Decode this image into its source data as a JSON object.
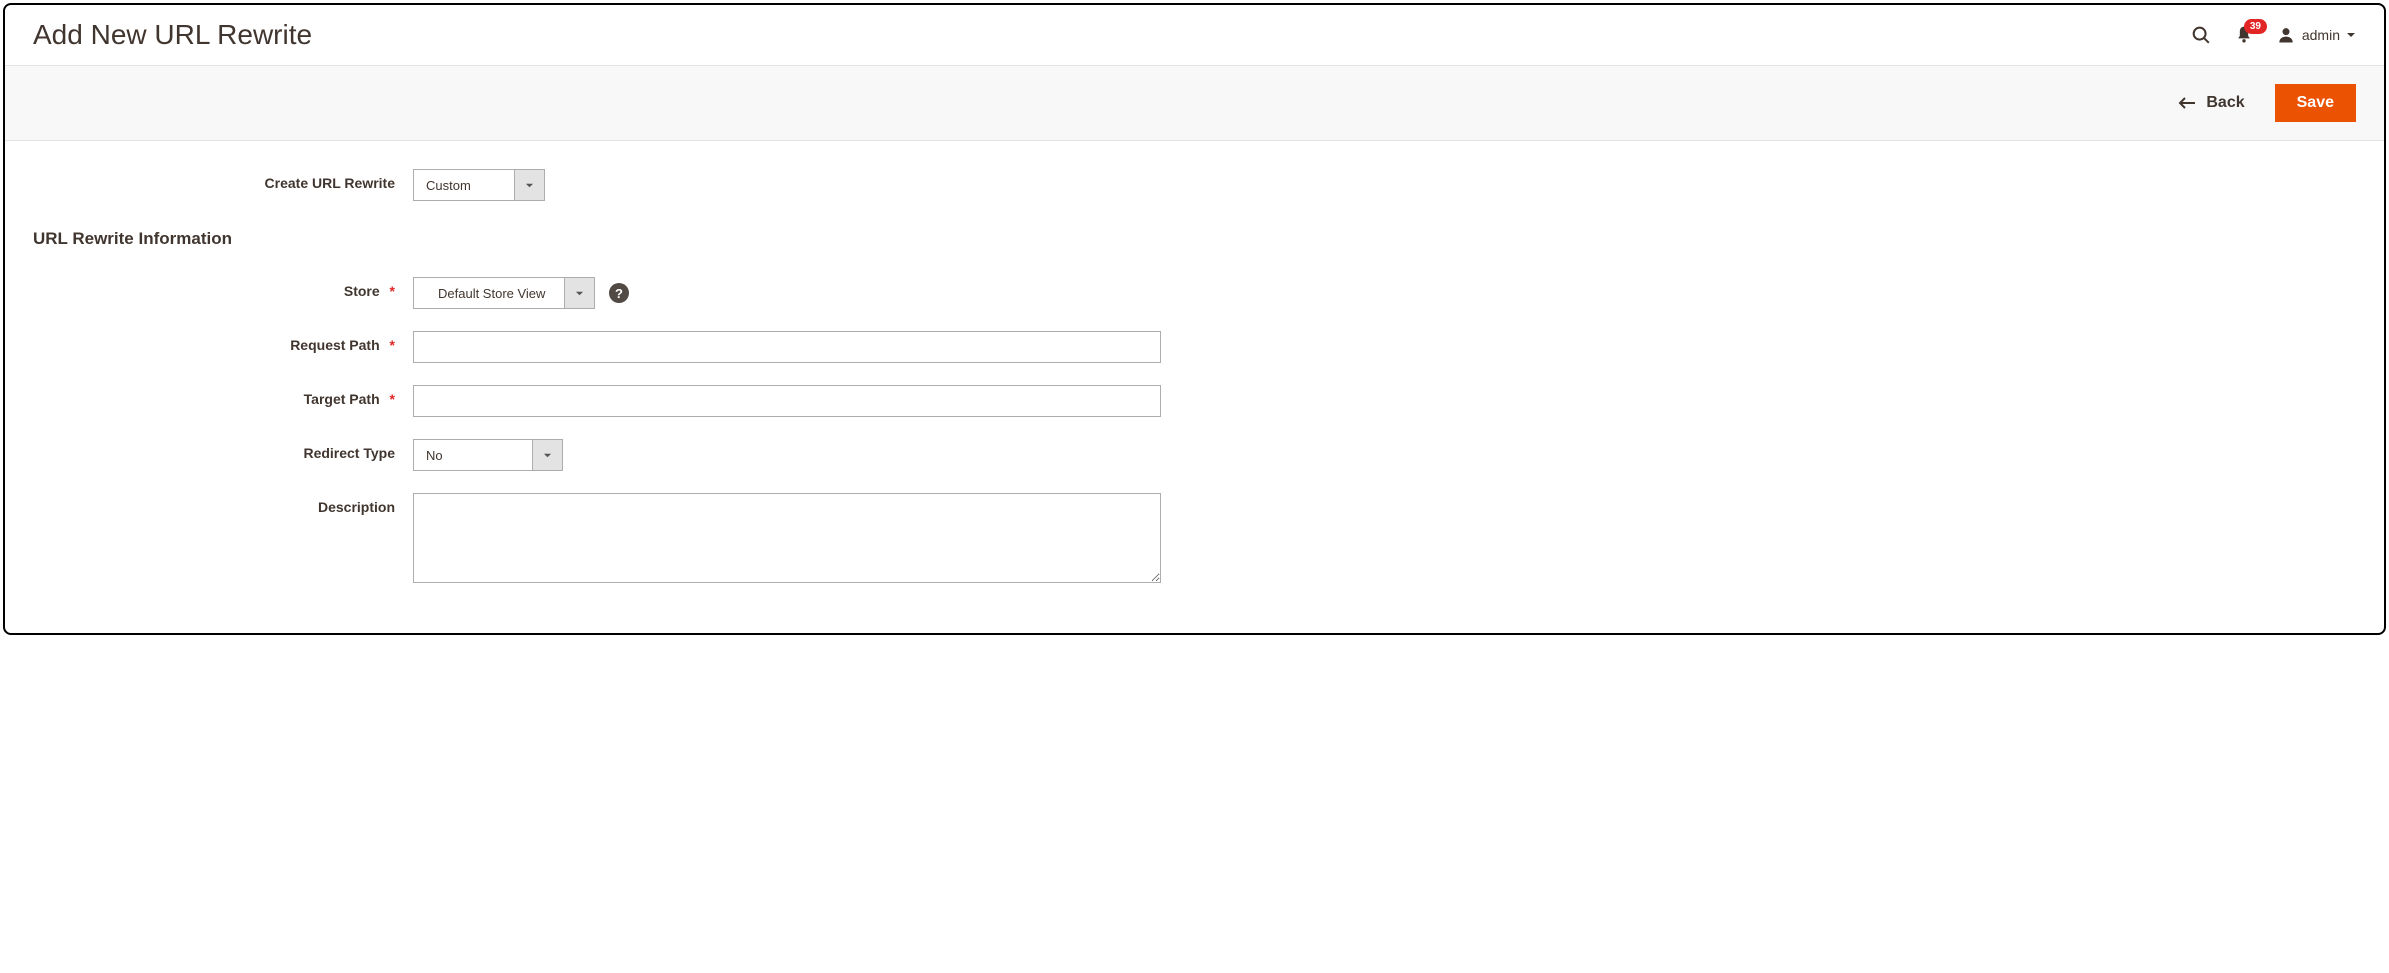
{
  "header": {
    "title": "Add New URL Rewrite",
    "notification_count": "39",
    "username": "admin"
  },
  "toolbar": {
    "back_label": "Back",
    "save_label": "Save"
  },
  "form": {
    "create_rewrite": {
      "label": "Create URL Rewrite",
      "value": "Custom"
    },
    "section_heading": "URL Rewrite Information",
    "store": {
      "label": "Store",
      "value": "Default Store View"
    },
    "request_path": {
      "label": "Request Path",
      "value": ""
    },
    "target_path": {
      "label": "Target Path",
      "value": ""
    },
    "redirect_type": {
      "label": "Redirect Type",
      "value": "No"
    },
    "description": {
      "label": "Description",
      "value": ""
    }
  },
  "icons": {
    "help": "?"
  }
}
